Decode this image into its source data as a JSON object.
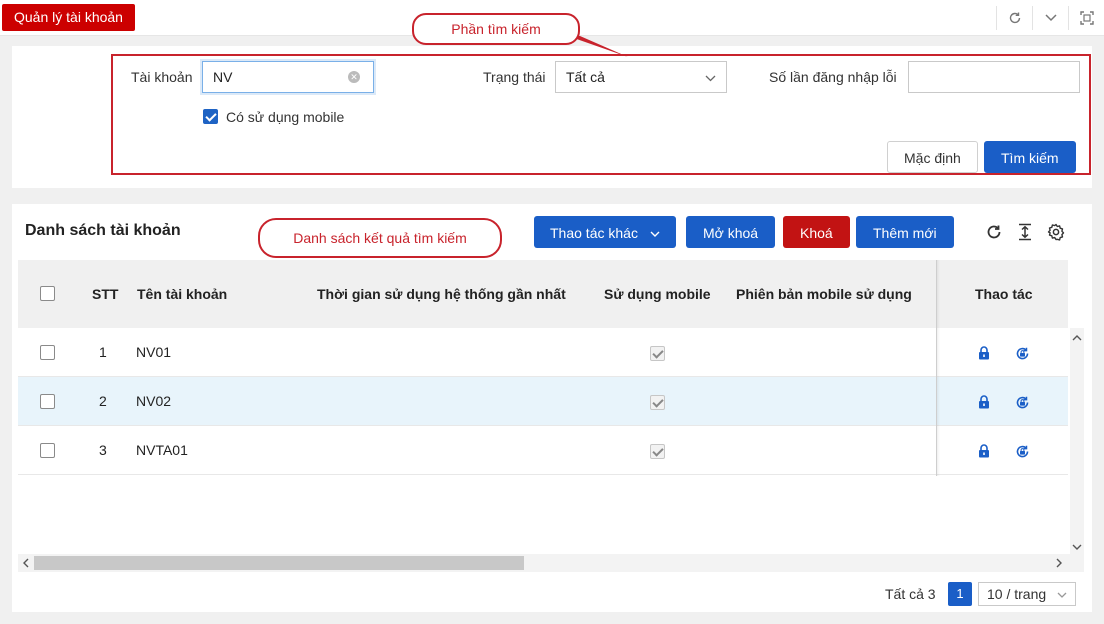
{
  "header": {
    "title": "Quản lý tài khoản",
    "icons": [
      "refresh-icon",
      "chevron-down-icon",
      "fullscreen-icon"
    ]
  },
  "search": {
    "account_label": "Tài khoản",
    "account_value": "NV",
    "status_label": "Trạng thái",
    "status_value": "Tất cả",
    "failed_login_label": "Số lần đăng nhập lỗi",
    "failed_login_value": "",
    "mobile_checkbox_label": "Có sử dụng mobile",
    "mobile_checked": true,
    "default_button": "Mặc định",
    "search_button": "Tìm kiếm"
  },
  "callouts": {
    "search_section": "Phần tìm kiếm",
    "results_section": "Danh sách kết quả tìm kiếm"
  },
  "list": {
    "title": "Danh sách tài khoản",
    "buttons": {
      "other_actions": "Thao tác khác",
      "unlock": "Mở khoá",
      "lock": "Khoá",
      "add_new": "Thêm mới"
    },
    "columns": {
      "index": "STT",
      "account_name": "Tên tài khoản",
      "last_used": "Thời gian sử dụng hệ thống gần nhất",
      "uses_mobile": "Sử dụng mobile",
      "mobile_version": "Phiên bản mobile sử dụng",
      "actions": "Thao tác"
    },
    "rows": [
      {
        "index": "1",
        "account_name": "NV01",
        "last_used": "",
        "uses_mobile": true,
        "mobile_version": ""
      },
      {
        "index": "2",
        "account_name": "NV02",
        "last_used": "",
        "uses_mobile": true,
        "mobile_version": ""
      },
      {
        "index": "3",
        "account_name": "NVTA01",
        "last_used": "",
        "uses_mobile": true,
        "mobile_version": ""
      }
    ]
  },
  "pagination": {
    "total": "Tất cả 3",
    "current_page": "1",
    "page_size": "10 / trang"
  },
  "colors": {
    "brand_red": "#c00000",
    "primary_blue": "#1a5ec7",
    "callout_red": "#c8232c"
  }
}
